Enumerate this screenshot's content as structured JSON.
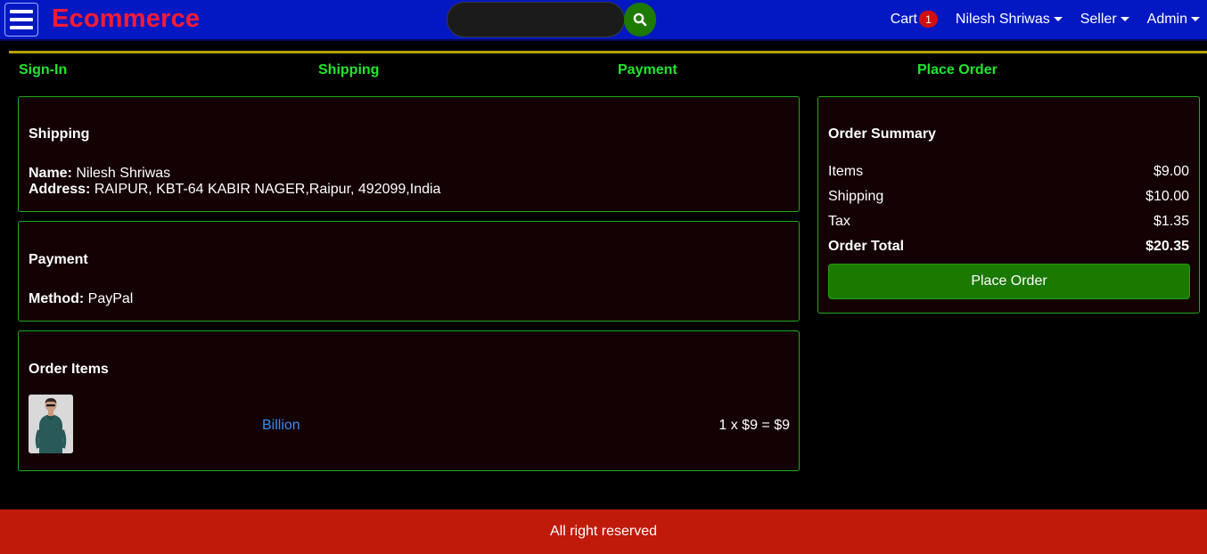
{
  "header": {
    "brand": "Ecommerce",
    "search": {
      "value": "",
      "placeholder": ""
    },
    "nav": {
      "cart_label": "Cart",
      "cart_count": "1",
      "user_label": "Nilesh Shriwas",
      "seller_label": "Seller",
      "admin_label": "Admin"
    }
  },
  "steps": [
    "Sign-In",
    "Shipping",
    "Payment",
    "Place Order"
  ],
  "shipping": {
    "title": "Shipping",
    "name_label": "Name:",
    "name_value": "Nilesh Shriwas",
    "address_label": "Address:",
    "address_value": "RAIPUR, KBT-64 KABIR NAGER,Raipur, 492099,India"
  },
  "payment": {
    "title": "Payment",
    "method_label": "Method:",
    "method_value": "PayPal"
  },
  "order_items": {
    "title": "Order Items",
    "items": [
      {
        "name": "Billion",
        "price_line": "1 x $9 = $9"
      }
    ]
  },
  "summary": {
    "title": "Order Summary",
    "rows": [
      {
        "label": "Items",
        "value": "$9.00"
      },
      {
        "label": "Shipping",
        "value": "$10.00"
      },
      {
        "label": "Tax",
        "value": "$1.35"
      }
    ],
    "total_label": "Order Total",
    "total_value": "$20.35",
    "button_label": "Place Order"
  },
  "footer": {
    "text": "All right reserved"
  },
  "colors": {
    "header_bg": "#0318c2",
    "brand": "#ff1a33",
    "step_active": "#21e52f",
    "card_border": "#1fa81f",
    "card_bg": "#130103",
    "button_green": "#1a7a00",
    "link": "#3b8cf0",
    "footer_bg": "#bf1a0a",
    "badge": "#d01010"
  },
  "icons": {
    "menu": "hamburger-menu-icon",
    "search": "search-icon",
    "caret": "caret-down-icon"
  }
}
